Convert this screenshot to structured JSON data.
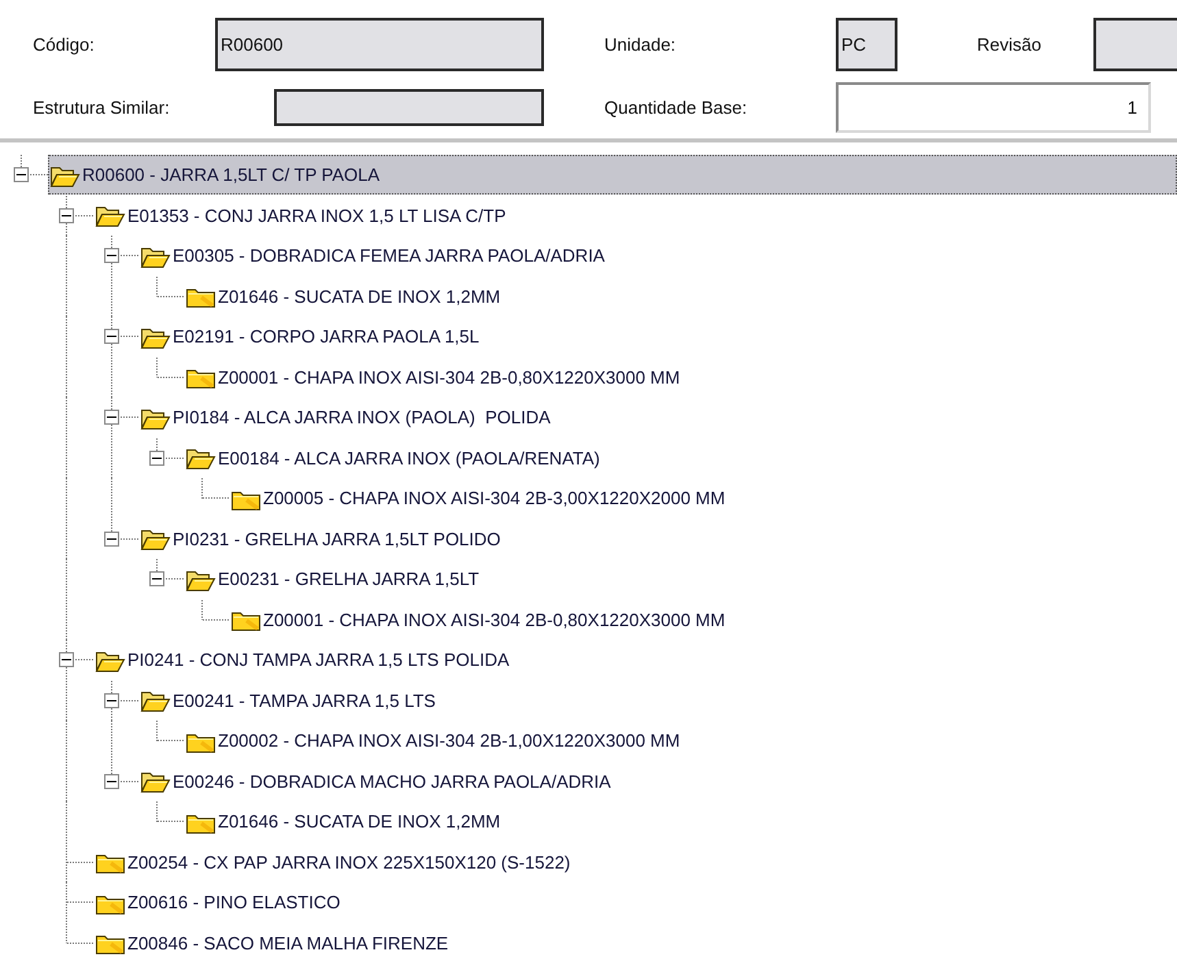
{
  "form": {
    "rows": [
      [
        {
          "label": "Código:",
          "value": "R00600",
          "kind": "text",
          "disabled": true
        },
        {
          "label": "Unidade:",
          "value": "PC",
          "kind": "text",
          "disabled": true
        },
        {
          "label": "Revisão",
          "kind": "text",
          "disabled": true
        }
      ],
      [
        {
          "label": "Estrutura Similar:",
          "kind": "text",
          "disabled": true
        },
        {
          "label": "Quantidade Base:",
          "value": "1",
          "kind": "number",
          "disabled": false
        }
      ]
    ]
  },
  "tree": {
    "root": {
      "label": "R00600 - JARRA 1,5LT C/ TP PAOLA",
      "selected": true,
      "expanded": true,
      "children": [
        {
          "label": "E01353 - CONJ JARRA INOX 1,5 LT LISA C/TP",
          "selected": false,
          "expanded": true,
          "children": [
            {
              "label": "E00305 - DOBRADICA FEMEA JARRA PAOLA/ADRIA",
              "selected": false,
              "expanded": true,
              "children": [
                {
                  "label": "Z01646 - SUCATA DE INOX 1,2MM",
                  "selected": false
                }
              ]
            },
            {
              "label": "E02191 - CORPO JARRA PAOLA 1,5L",
              "selected": false,
              "expanded": true,
              "children": [
                {
                  "label": "Z00001 - CHAPA INOX AISI-304 2B-0,80X1220X3000 MM",
                  "selected": false
                }
              ]
            },
            {
              "label": "PI0184 - ALCA JARRA INOX (PAOLA)  POLIDA",
              "selected": false,
              "expanded": true,
              "children": [
                {
                  "label": "E00184 - ALCA JARRA INOX (PAOLA/RENATA)",
                  "selected": false,
                  "expanded": true,
                  "children": [
                    {
                      "label": "Z00005 - CHAPA INOX AISI-304 2B-3,00X1220X2000 MM",
                      "selected": false
                    }
                  ]
                }
              ]
            },
            {
              "label": "PI0231 - GRELHA JARRA 1,5LT POLIDO",
              "selected": false,
              "expanded": true,
              "children": [
                {
                  "label": "E00231 - GRELHA JARRA 1,5LT",
                  "selected": false,
                  "expanded": true,
                  "children": [
                    {
                      "label": "Z00001 - CHAPA INOX AISI-304 2B-0,80X1220X3000 MM",
                      "selected": false
                    }
                  ]
                }
              ]
            }
          ]
        },
        {
          "label": "PI0241 - CONJ TAMPA JARRA 1,5 LTS POLIDA",
          "selected": false,
          "expanded": true,
          "children": [
            {
              "label": "E00241 - TAMPA JARRA 1,5 LTS",
              "selected": false,
              "expanded": true,
              "children": [
                {
                  "label": "Z00002 - CHAPA INOX AISI-304 2B-1,00X1220X3000 MM",
                  "selected": false
                }
              ]
            },
            {
              "label": "E00246 - DOBRADICA MACHO JARRA PAOLA/ADRIA",
              "selected": false,
              "expanded": true,
              "children": [
                {
                  "label": "Z01646 - SUCATA DE INOX 1,2MM",
                  "selected": false
                }
              ]
            }
          ]
        },
        {
          "label": "Z00254 - CX PAP JARRA INOX 225X150X120 (S-1522)",
          "selected": false
        },
        {
          "label": "Z00616 - PINO ELASTICO",
          "selected": false
        },
        {
          "label": "Z00846 - SACO MEIA MALHA FIRENZE",
          "selected": false
        }
      ]
    }
  }
}
